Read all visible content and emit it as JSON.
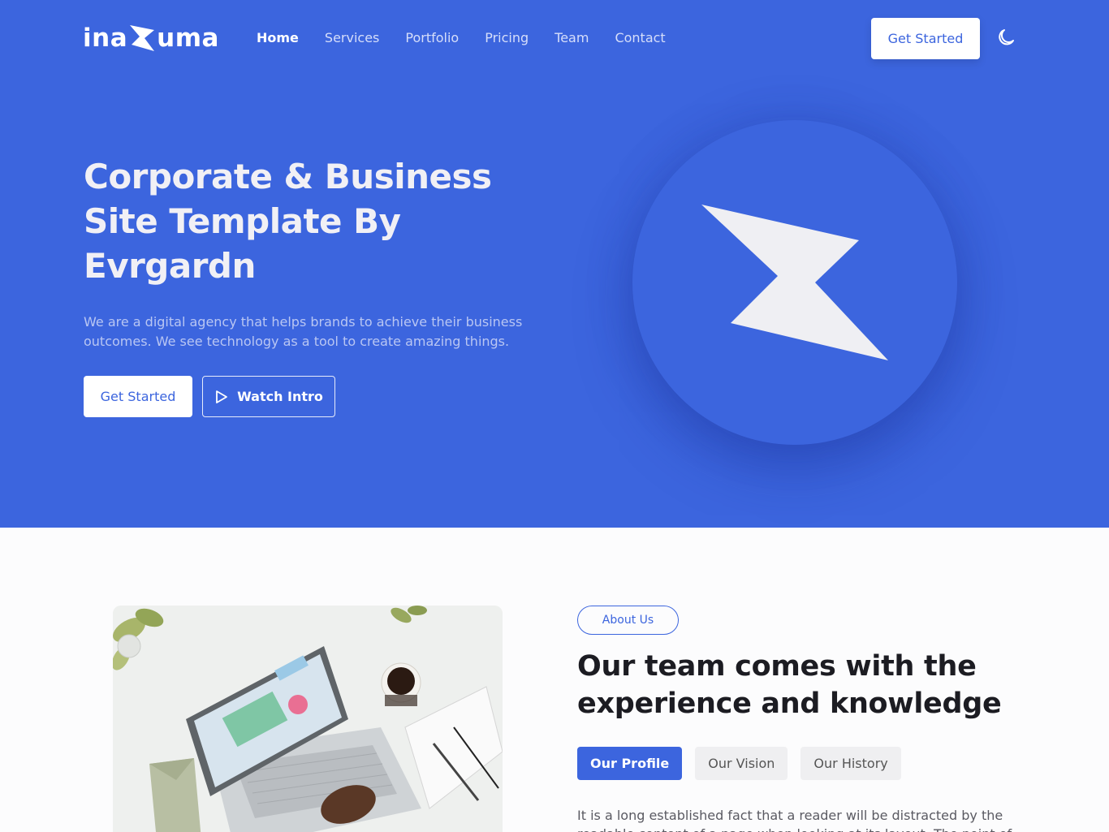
{
  "brand": {
    "logo_left": "ina",
    "logo_right": "uma",
    "accent": "#3c65de"
  },
  "nav": {
    "items": [
      {
        "label": "Home",
        "active": true
      },
      {
        "label": "Services"
      },
      {
        "label": "Portfolio"
      },
      {
        "label": "Pricing"
      },
      {
        "label": "Team"
      },
      {
        "label": "Contact"
      }
    ],
    "cta_label": "Get Started",
    "theme_icon": "moon-icon"
  },
  "hero": {
    "title": "Corporate & Business Site Template By Evrgardn",
    "description": "We are a digital agency that helps brands to achieve their business outcomes. We see technology as a tool to create amazing things.",
    "primary_label": "Get Started",
    "secondary_label": "Watch Intro",
    "secondary_icon": "play-icon"
  },
  "about": {
    "badge": "About Us",
    "title": "Our team comes with the experience and knowledge",
    "tabs": [
      {
        "label": "Our Profile",
        "active": true
      },
      {
        "label": "Our Vision"
      },
      {
        "label": "Our History"
      }
    ],
    "text": "It is a long established fact that a reader will be distracted by the readable content of a page when looking at its layout. The point of"
  }
}
